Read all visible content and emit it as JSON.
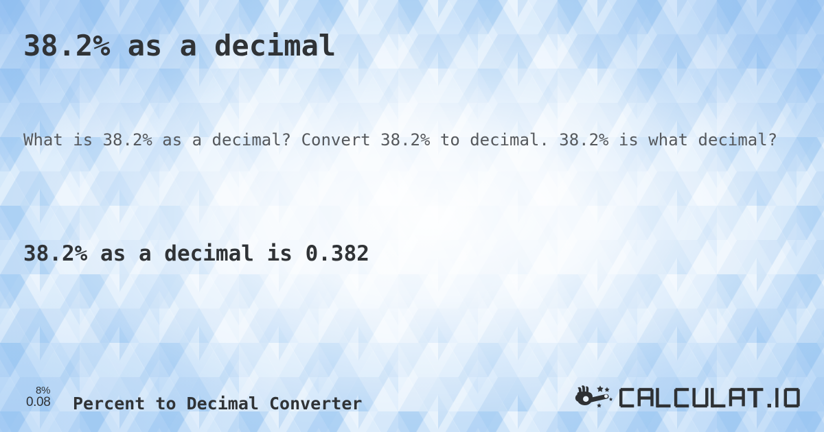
{
  "page": {
    "title": "38.2% as a decimal",
    "lead": "What is 38.2% as a decimal? Convert 38.2% to decimal. 38.2% is what decimal?",
    "answer": "38.2% as a decimal is 0.382"
  },
  "footer": {
    "icon": {
      "name": "percent-to-decimal-icon",
      "top": "8%",
      "bottom": "0.08"
    },
    "label": "Percent to Decimal Converter",
    "logo": {
      "name": "calculatio-logo",
      "mark": "hand-magic-wand-icon",
      "text": "CALCULAT.IO"
    }
  },
  "colors": {
    "background_blue": "#b7d8f7",
    "background_light": "#ffffff",
    "heading_text": "#303336",
    "body_text": "#55585c",
    "logo_text": "#2e3134"
  }
}
